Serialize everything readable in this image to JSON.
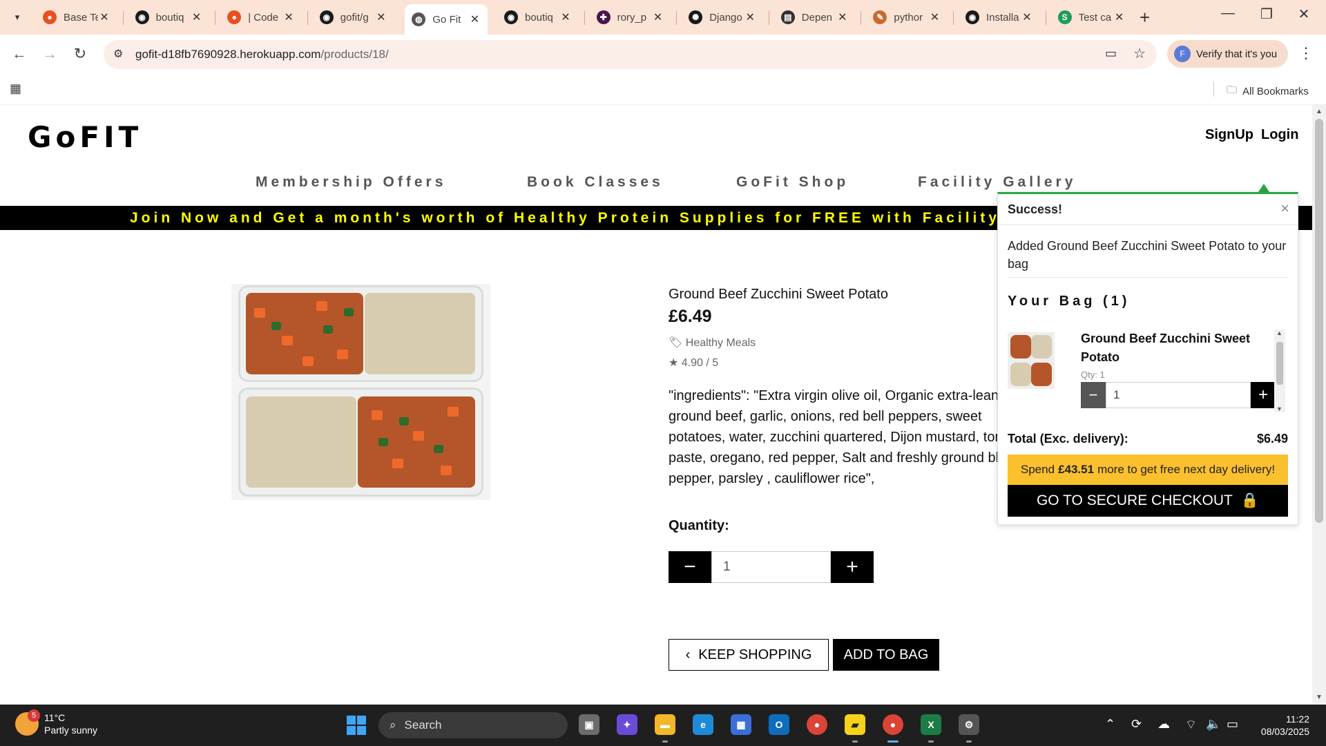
{
  "browser": {
    "tabs": [
      {
        "title": "Base Te",
        "icon": "circle-icon",
        "color": "#e8501f"
      },
      {
        "title": "boutiq",
        "icon": "github-icon",
        "color": "#1a1a1a"
      },
      {
        "title": "| Code",
        "icon": "circle-icon",
        "color": "#e8501f"
      },
      {
        "title": "gofit/g",
        "icon": "github-icon",
        "color": "#1a1a1a"
      },
      {
        "title": "Go Fit",
        "icon": "globe-icon",
        "color": "#555555"
      },
      {
        "title": "boutiq",
        "icon": "github-icon",
        "color": "#1a1a1a"
      },
      {
        "title": "rory_p",
        "icon": "slack-icon",
        "color": "#4a154b"
      },
      {
        "title": "Django",
        "icon": "openai-icon",
        "color": "#1a1a1a"
      },
      {
        "title": "Depen",
        "icon": "table-icon",
        "color": "#333333"
      },
      {
        "title": "pythor",
        "icon": "pen-icon",
        "color": "#c96a2d"
      },
      {
        "title": "Installa",
        "icon": "github-icon",
        "color": "#1a1a1a"
      },
      {
        "title": "Test ca",
        "icon": "sheets-icon",
        "color": "#1e9e5a"
      }
    ],
    "url_host": "gofit-d18fb7690928.herokuapp.com",
    "url_path": "/products/18/",
    "profile_label": "Verify that it's you",
    "profile_initial": "F",
    "all_bookmarks": "All Bookmarks"
  },
  "site": {
    "logo": "GoFIT",
    "signup": "SignUp",
    "login": "Login",
    "nav": [
      "Membership Offers",
      "Book Classes",
      "GoFit Shop",
      "Facility Gallery"
    ],
    "promo": "Join Now and Get a month's worth of Healthy Protein Supplies for FREE with Facility"
  },
  "product": {
    "name": "Ground Beef Zucchini Sweet Potato",
    "price": "£6.49",
    "category": "Healthy Meals",
    "rating": "4.90 / 5",
    "description": "\"ingredients\": \"Extra virgin olive oil, Organic extra-lean ground beef, garlic, onions, red bell peppers, sweet potatoes, water, zucchini quartered, Dijon mustard, tomato paste, oregano, red pepper, Salt and freshly ground black pepper, parsley , cauliflower rice\",",
    "quantity_label": "Quantity:",
    "quantity_value": "1",
    "keep_shopping": "KEEP SHOPPING",
    "add_to_bag": "ADD TO BAG"
  },
  "toast": {
    "heading": "Success!",
    "close": "×",
    "message": "Added Ground Beef Zucchini Sweet Potato to your bag",
    "bag_title": "Your Bag (1)",
    "item_name": "Ground Beef Zucchini Sweet Potato",
    "item_qty_label": "Qty: 1",
    "item_qty_value": "1",
    "total_label": "Total (Exc. delivery):",
    "total_value": "$6.49",
    "spend_prefix": "Spend",
    "spend_amount": "£43.51",
    "spend_suffix": "more to get free next day delivery!",
    "checkout": "GO TO SECURE CHECKOUT",
    "accent": "#28a745",
    "banner_color": "#fbc02d"
  },
  "taskbar": {
    "weather_temp": "11°C",
    "weather_desc": "Partly sunny",
    "weather_badge": "5",
    "search_placeholder": "Search",
    "time": "11:22",
    "date": "08/03/2025"
  }
}
